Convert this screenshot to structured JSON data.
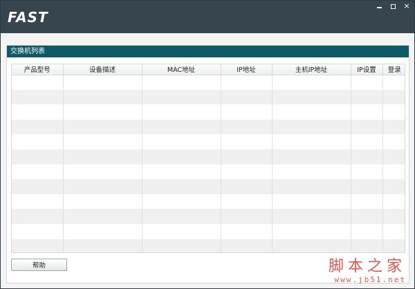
{
  "window": {
    "logo": "FAST",
    "minimize_label": "",
    "close_label": "×"
  },
  "panel": {
    "title": "交换机列表"
  },
  "table": {
    "columns": [
      "产品型号",
      "设备描述",
      "MAC地址",
      "IP地址",
      "主机IP地址",
      "IP设置",
      "登录"
    ],
    "row_count": 12
  },
  "footer": {
    "help_label": "帮助"
  },
  "watermark": {
    "main": "脚本之家",
    "sub": "www.jb51.net"
  }
}
